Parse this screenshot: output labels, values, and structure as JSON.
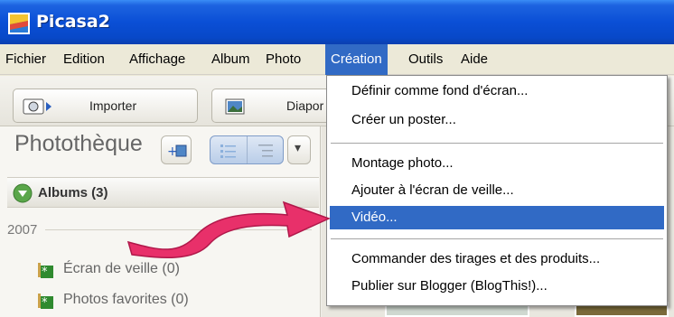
{
  "window": {
    "title": "Picasa2"
  },
  "menubar": {
    "items": [
      "Fichier",
      "Edition",
      "Affichage",
      "Album",
      "Photo",
      "Création",
      "Outils",
      "Aide"
    ],
    "active": "Création"
  },
  "toolbar": {
    "import_label": "Importer",
    "slideshow_label": "Diapor"
  },
  "library": {
    "title": "Photothèque",
    "albums_header": "Albums (3)",
    "year": "2007",
    "albums": [
      "Écran de veille (0)",
      "Photos favorites (0)"
    ]
  },
  "dropdown": {
    "items": [
      "Définir comme fond d'écran...",
      "Créer un poster...",
      "Montage photo...",
      "Ajouter à l'écran de veille...",
      "Vidéo...",
      "Commander des tirages et des produits...",
      "Publier sur Blogger (BlogThis!)..."
    ],
    "highlighted": "Vidéo..."
  },
  "colors": {
    "titlebar": "#0a4fd6",
    "highlight": "#316ac5",
    "arrow": "#e8306a"
  },
  "icons": [
    "picasa-logo-icon",
    "camera-import-icon",
    "slideshow-icon",
    "star-album-icon",
    "expand-arrow-icon",
    "red-pointer-arrow-icon"
  ]
}
